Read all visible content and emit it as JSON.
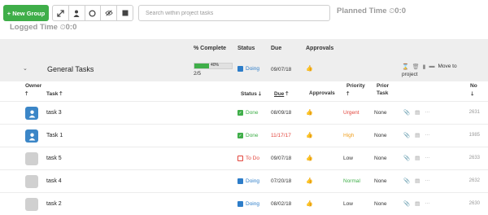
{
  "toolbar": {
    "new_group_label": "New Group",
    "search_placeholder": "Search within project tasks",
    "planned_time_label": "Planned Time",
    "planned_time_value": "0:0",
    "logged_time_label": "Logged Time",
    "logged_time_value": "0:0",
    "view_icons": [
      "expand-icon",
      "person-icon",
      "circle-icon",
      "eye-slash-icon",
      "square-icon"
    ]
  },
  "group": {
    "title": "General Tasks",
    "progress_percent": 40,
    "progress_label": "40%",
    "completed_fraction": "2/5",
    "status": "Doing",
    "due": "09/07/18",
    "move_label_1": "Move to",
    "move_label_2": "project",
    "header_labels": {
      "complete": "% Complete",
      "status": "Status",
      "due": "Due",
      "approvals": "Approvals"
    }
  },
  "columns": {
    "owner": "Owner",
    "task": "Task",
    "status": "Status",
    "due": "Due",
    "approvals": "Approvals",
    "priority": "Priority",
    "prior_task_1": "Prior",
    "prior_task_2": "Task",
    "no": "No"
  },
  "tasks": [
    {
      "task": "task 3",
      "status": "Done",
      "due": "08/09/18",
      "priority": "Urgent",
      "prior": "None",
      "no": "2631",
      "avatar": "person"
    },
    {
      "task": "Task 1",
      "status": "Done",
      "due": "11/17/17",
      "priority": "High",
      "prior": "None",
      "no": "1985",
      "avatar": "person"
    },
    {
      "task": "task 5",
      "status": "To Do",
      "due": "09/07/18",
      "priority": "Low",
      "prior": "None",
      "no": "2633",
      "avatar": "grey"
    },
    {
      "task": "task 4",
      "status": "Doing",
      "due": "07/20/18",
      "priority": "Normal",
      "prior": "None",
      "no": "2632",
      "avatar": "grey"
    },
    {
      "task": "task 2",
      "status": "Doing",
      "due": "08/02/18",
      "priority": "Low",
      "prior": "None",
      "no": "2630",
      "avatar": "grey"
    }
  ],
  "colors": {
    "accent_green": "#3fae49",
    "doing_blue": "#2d7dc9",
    "overdue_red": "#e2453c",
    "urgent": "#e2453c",
    "high": "#f0a020",
    "normal": "#3fae49",
    "low": "#333333"
  }
}
